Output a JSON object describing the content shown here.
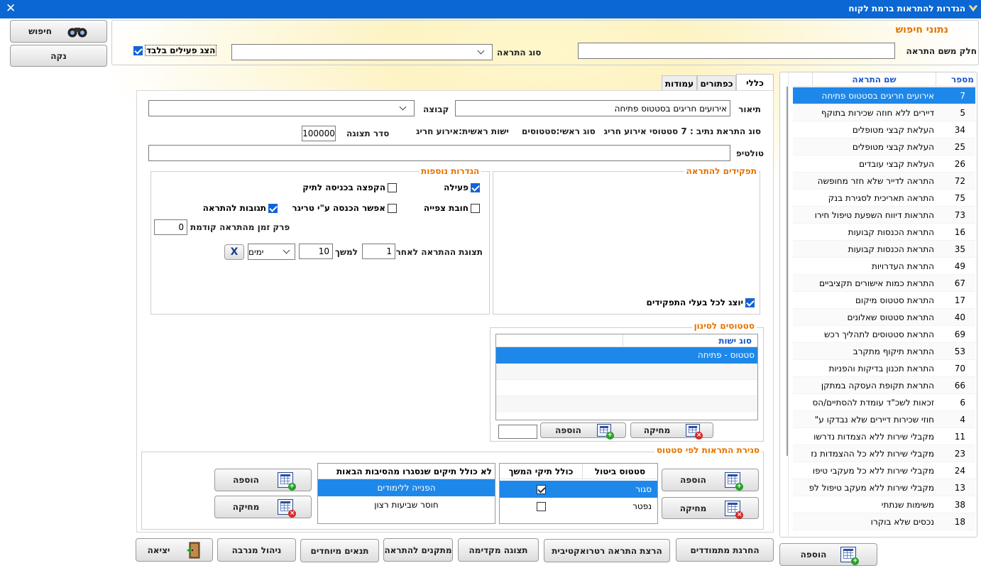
{
  "window": {
    "title": "הגדרות להתראות ברמת לקוח"
  },
  "search": {
    "section_title": "נתוני חיפוש",
    "name_label": "חלק משם התראה",
    "name_value": "",
    "type_label": "סוג התראה",
    "type_value": "",
    "active_only_label": "הצג פעילים בלבד",
    "active_only_checked": true,
    "search_button": "חיפוש",
    "clear_button": "נקה"
  },
  "alert_list": {
    "col_number": "מספר",
    "col_name": "שם התראה",
    "rows": [
      {
        "num": "7",
        "name": "אירועים חריגים בסטטוס פתיחה"
      },
      {
        "num": "5",
        "name": "דיירים ללא חוזה שכירות בתוקף"
      },
      {
        "num": "34",
        "name": "העלאת קבצי מטופלים"
      },
      {
        "num": "25",
        "name": "העלאת קבצי מטופלים"
      },
      {
        "num": "26",
        "name": "העלאת קבצי עובדים"
      },
      {
        "num": "72",
        "name": "התראה לדייר שלא חזר מחופשה"
      },
      {
        "num": "75",
        "name": "התראה תאריכית לסגירת בנק"
      },
      {
        "num": "73",
        "name": "התראות דיווח השפעת טיפול חירו"
      },
      {
        "num": "16",
        "name": "התראת הכנסות קבועות"
      },
      {
        "num": "35",
        "name": "התראת הכנסות קבועות"
      },
      {
        "num": "49",
        "name": "התראת העדרויות"
      },
      {
        "num": "67",
        "name": "התראת כמות אישורים תקציביים"
      },
      {
        "num": "17",
        "name": "התראת סטטוס מיקום"
      },
      {
        "num": "40",
        "name": "התראת סטטוס שאלונים"
      },
      {
        "num": "69",
        "name": "התראת סטטוסים לתהליך רכש"
      },
      {
        "num": "53",
        "name": "התראת תיקוף מתקרב"
      },
      {
        "num": "70",
        "name": "התראת תכנון בדיקות והפניות"
      },
      {
        "num": "66",
        "name": "התראת תקופת העסקה במתקן"
      },
      {
        "num": "6",
        "name": "זכאות לשכ\"ד עומדת להסתיים/הס"
      },
      {
        "num": "4",
        "name": "חוזי שכירות דיירים שלא נבדקו ע\""
      },
      {
        "num": "11",
        "name": "מקבלי שירות ללא הצמדות נדרשו"
      },
      {
        "num": "23",
        "name": "מקבלי שירות ללא כל ההצמדות נז"
      },
      {
        "num": "24",
        "name": "מקבלי שירות ללא כל מעקבי טיפו"
      },
      {
        "num": "13",
        "name": "מקבלי שירות ללא מעקב טיפול לפ"
      },
      {
        "num": "38",
        "name": "משימות שנתתי"
      },
      {
        "num": "18",
        "name": "נכסים שלא בוקרו"
      }
    ],
    "add_button": "הוספה"
  },
  "tabs": [
    "כללי",
    "כפתורים",
    "עמודות"
  ],
  "general": {
    "description_label": "תיאור",
    "description_value": "אירועים חריגים בסטטוס פתיחה",
    "group_label": "קבוצה",
    "group_value": "",
    "type_info": "סוג התראת נתיב : 7 סטטוסי אירוע חריג",
    "main_type_info": "סוג ראשי:סטטוסים",
    "main_entity_info": "ישות ראשית:אירוע חריג",
    "display_order_label": "סדר תצוגה",
    "display_order_value": "100000",
    "tooltip_label": "טולטיפ",
    "tooltip_value": ""
  },
  "roles": {
    "title": "תפקידים להתראה",
    "show_all_label": "יוצג לכל בעלי התפקידים",
    "show_all_checked": true
  },
  "extra": {
    "title": "הגדרות נוספות",
    "active_label": "פעילה",
    "active_checked": true,
    "popup_label": "הקפצה בכניסה לתיק",
    "popup_checked": false,
    "must_view_label": "חובת צפייה",
    "must_view_checked": false,
    "trigger_label": "אפשר הכנסה ע\"י טריגר",
    "trigger_checked": false,
    "responses_label": "תגובות להתראה",
    "responses_checked": true,
    "time_gap_label": "פרק זמן מהתראה קודמת",
    "time_gap_value": "0",
    "show_after_label": "תצוגת ההתראה לאחר",
    "show_after_value": "1",
    "duration_label": "למשך",
    "duration_value": "10",
    "unit_value": "ימים",
    "clear_x": "X"
  },
  "filter_statuses": {
    "title": "סטטוסים לסינון",
    "col_entity_type": "סוג ישות",
    "rows": [
      "סטטוס - פתיחה"
    ],
    "add_button": "הוספה",
    "delete_button": "מחיקה",
    "small_value": ""
  },
  "close_by_status": {
    "title": "סגירת התראות לפי סטטוס",
    "col_cancel_status": "סטטוס ביטול",
    "col_include_cases": "כולל תיקי המשך",
    "rows": [
      {
        "status": "סגור",
        "include": true
      },
      {
        "status": "נפטר",
        "include": false
      }
    ],
    "add_button": "הוספה",
    "delete_button": "מחיקה",
    "reasons_header": "לא כולל תיקים שנסגרו מהסיבות הבאות",
    "reasons": [
      "הפנייה ללימודים",
      "חוסר שביעות רצון"
    ],
    "reasons_add_button": "הוספה",
    "reasons_delete_button": "מחיקה"
  },
  "footer": {
    "run_dependents": "החרגת מתמודדים",
    "run_retro": "הרצת התראה רטרואקטיבית",
    "preview": "תצוגה מקדימה",
    "fixers": "מתקנים להתראה",
    "special": "תנאים מיוחדים",
    "admin": "ניהול מנרבה",
    "exit": "יציאה"
  },
  "colors": {
    "titlebar": "#0a67d3",
    "selection": "#1e88ea",
    "section_title": "#e57200"
  }
}
